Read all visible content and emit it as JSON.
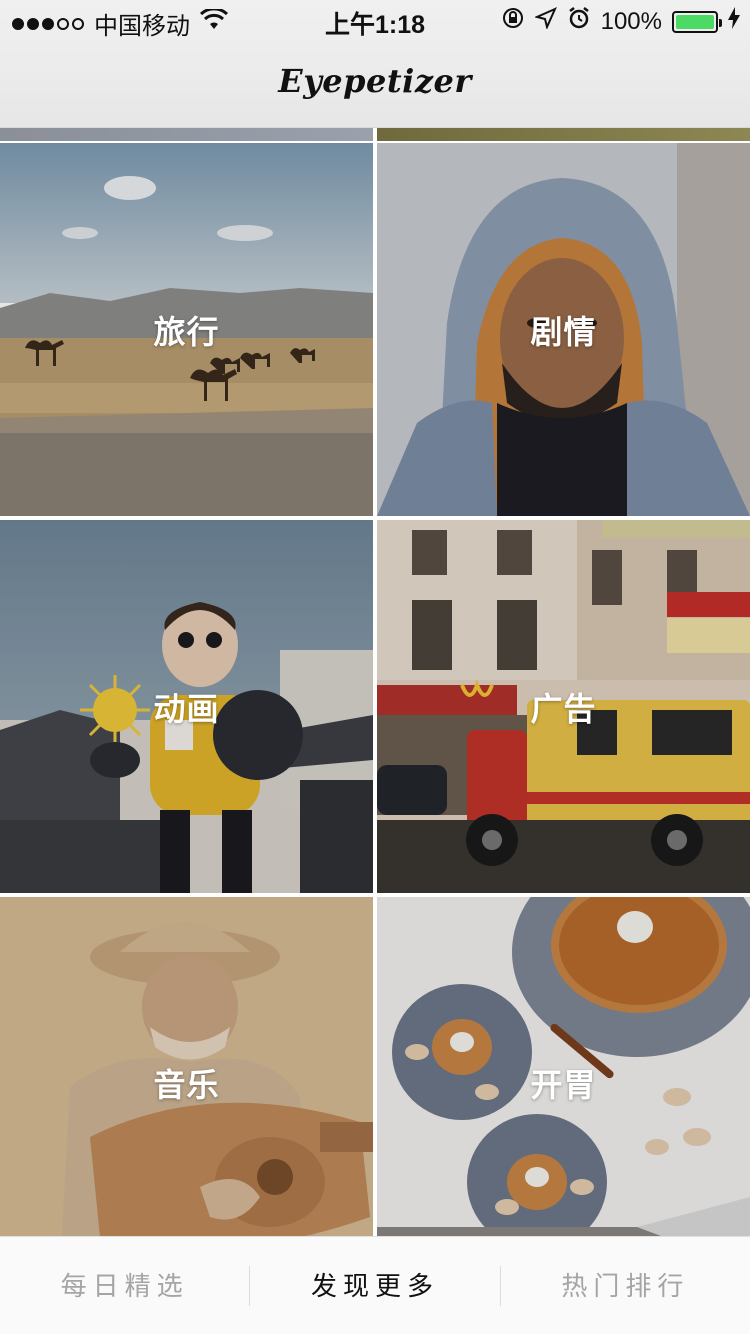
{
  "status_bar": {
    "carrier": "中国移动",
    "time": "上午1:18",
    "battery_percent": "100%",
    "battery_level": 1.0,
    "icons": [
      "signal-dots",
      "wifi-icon",
      "orientation-lock-icon",
      "location-icon",
      "alarm-icon",
      "battery-icon",
      "charging-icon"
    ]
  },
  "nav": {
    "title": "Eyepetizer"
  },
  "categories": [
    {
      "label": "旅行"
    },
    {
      "label": "剧情"
    },
    {
      "label": "动画"
    },
    {
      "label": "广告"
    },
    {
      "label": "音乐"
    },
    {
      "label": "开胃"
    }
  ],
  "tabbar": {
    "tabs": [
      {
        "label": "每日精选",
        "active": false
      },
      {
        "label": "发现更多",
        "active": true
      },
      {
        "label": "热门排行",
        "active": false
      }
    ]
  }
}
